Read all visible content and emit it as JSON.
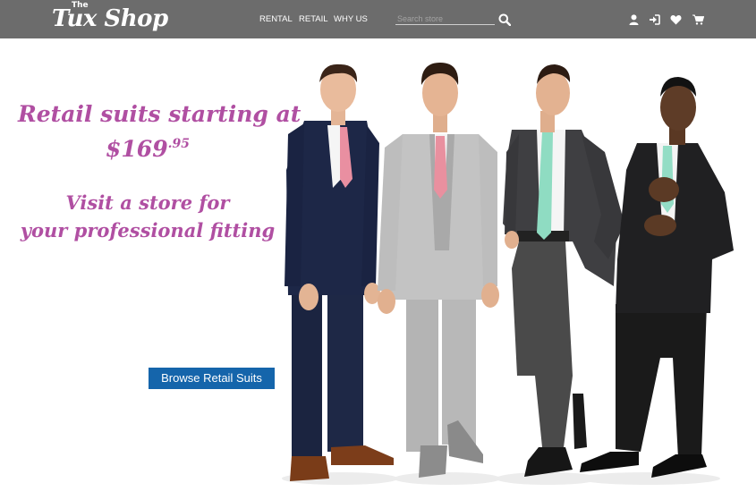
{
  "header": {
    "logo_small": "The",
    "logo_main": "Tux Shop",
    "nav": [
      {
        "label": "RENTAL"
      },
      {
        "label": "RETAIL"
      },
      {
        "label": "WHY US"
      }
    ],
    "search": {
      "placeholder": "Search store",
      "value": ""
    },
    "icons": [
      "search-icon",
      "user-icon",
      "sign-in-icon",
      "heart-icon",
      "cart-icon"
    ],
    "background_color": "#6c6c6c"
  },
  "hero": {
    "headline": "Retail suits starting at",
    "price": "$169",
    "price_cents": ".95",
    "sub_line1": "Visit a store for",
    "sub_line2": "your professional fitting",
    "cta_label": "Browse Retail Suits",
    "accent_color": "#b04fa2",
    "cta_color": "#1565ab"
  },
  "photo": {
    "suit_colors": [
      "navy",
      "light-gray",
      "charcoal",
      "black"
    ],
    "tie_colors": [
      "pink",
      "pink",
      "mint",
      "mint"
    ]
  }
}
